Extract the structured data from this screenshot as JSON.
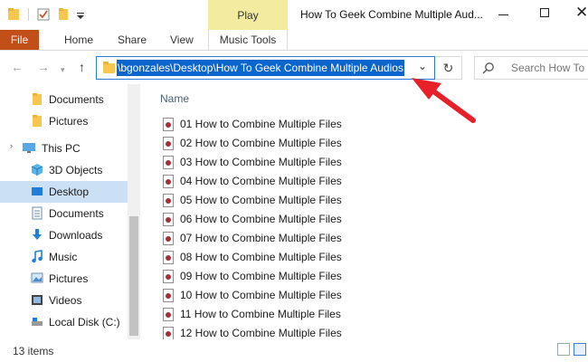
{
  "window": {
    "title": "How To Geek Combine Multiple Aud...",
    "contextual_tab": "Play",
    "minimize_icon": "minimize-icon",
    "maximize_icon": "maximize-icon",
    "close_icon": "close-icon"
  },
  "ribbon": {
    "tabs": [
      {
        "label": "File"
      },
      {
        "label": "Home"
      },
      {
        "label": "Share"
      },
      {
        "label": "View"
      },
      {
        "label": "Music Tools"
      }
    ]
  },
  "address_bar": {
    "path": "\\bgonzales\\Desktop\\How To Geek Combine Multiple Audios",
    "search_placeholder": "Search How To G"
  },
  "nav_pane": {
    "items": [
      {
        "label": "Documents",
        "icon": "folder-icon"
      },
      {
        "label": "Pictures",
        "icon": "folder-icon"
      },
      {
        "label": "This PC",
        "icon": "computer-icon"
      },
      {
        "label": "3D Objects",
        "icon": "3d-objects-icon"
      },
      {
        "label": "Desktop",
        "icon": "desktop-icon",
        "selected": true
      },
      {
        "label": "Documents",
        "icon": "documents-icon"
      },
      {
        "label": "Downloads",
        "icon": "downloads-icon"
      },
      {
        "label": "Music",
        "icon": "music-icon"
      },
      {
        "label": "Pictures",
        "icon": "pictures-icon"
      },
      {
        "label": "Videos",
        "icon": "videos-icon"
      },
      {
        "label": "Local Disk (C:)",
        "icon": "disk-icon"
      }
    ]
  },
  "content": {
    "column_header": "Name",
    "files": [
      "01 How to Combine Multiple Files",
      "02 How to Combine Multiple Files",
      "03 How to Combine Multiple Files",
      "04 How to Combine Multiple Files",
      "05 How to Combine Multiple Files",
      "06 How to Combine Multiple Files",
      "07 How to Combine Multiple Files",
      "08 How to Combine Multiple Files",
      "09 How to Combine Multiple Files",
      "10 How to Combine Multiple Files",
      "11 How to Combine Multiple Files",
      "12 How to Combine Multiple Files"
    ]
  },
  "status": {
    "item_count": "13 items"
  },
  "colors": {
    "file_tab": "#c24f17",
    "contextual_tab": "#f3eca0",
    "selection": "#0a66cc",
    "annotation_arrow": "#e8202a"
  }
}
